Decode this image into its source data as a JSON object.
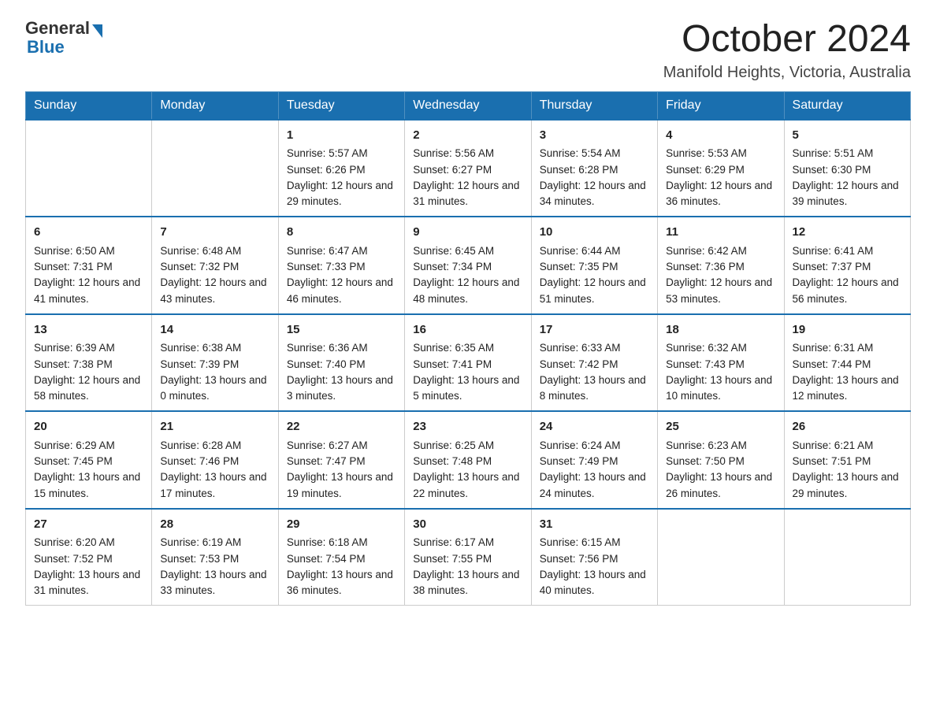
{
  "logo": {
    "text_general": "General",
    "text_blue": "Blue"
  },
  "title": "October 2024",
  "subtitle": "Manifold Heights, Victoria, Australia",
  "days_of_week": [
    "Sunday",
    "Monday",
    "Tuesday",
    "Wednesday",
    "Thursday",
    "Friday",
    "Saturday"
  ],
  "weeks": [
    [
      {
        "day": "",
        "sunrise": "",
        "sunset": "",
        "daylight": ""
      },
      {
        "day": "",
        "sunrise": "",
        "sunset": "",
        "daylight": ""
      },
      {
        "day": "1",
        "sunrise": "Sunrise: 5:57 AM",
        "sunset": "Sunset: 6:26 PM",
        "daylight": "Daylight: 12 hours and 29 minutes."
      },
      {
        "day": "2",
        "sunrise": "Sunrise: 5:56 AM",
        "sunset": "Sunset: 6:27 PM",
        "daylight": "Daylight: 12 hours and 31 minutes."
      },
      {
        "day": "3",
        "sunrise": "Sunrise: 5:54 AM",
        "sunset": "Sunset: 6:28 PM",
        "daylight": "Daylight: 12 hours and 34 minutes."
      },
      {
        "day": "4",
        "sunrise": "Sunrise: 5:53 AM",
        "sunset": "Sunset: 6:29 PM",
        "daylight": "Daylight: 12 hours and 36 minutes."
      },
      {
        "day": "5",
        "sunrise": "Sunrise: 5:51 AM",
        "sunset": "Sunset: 6:30 PM",
        "daylight": "Daylight: 12 hours and 39 minutes."
      }
    ],
    [
      {
        "day": "6",
        "sunrise": "Sunrise: 6:50 AM",
        "sunset": "Sunset: 7:31 PM",
        "daylight": "Daylight: 12 hours and 41 minutes."
      },
      {
        "day": "7",
        "sunrise": "Sunrise: 6:48 AM",
        "sunset": "Sunset: 7:32 PM",
        "daylight": "Daylight: 12 hours and 43 minutes."
      },
      {
        "day": "8",
        "sunrise": "Sunrise: 6:47 AM",
        "sunset": "Sunset: 7:33 PM",
        "daylight": "Daylight: 12 hours and 46 minutes."
      },
      {
        "day": "9",
        "sunrise": "Sunrise: 6:45 AM",
        "sunset": "Sunset: 7:34 PM",
        "daylight": "Daylight: 12 hours and 48 minutes."
      },
      {
        "day": "10",
        "sunrise": "Sunrise: 6:44 AM",
        "sunset": "Sunset: 7:35 PM",
        "daylight": "Daylight: 12 hours and 51 minutes."
      },
      {
        "day": "11",
        "sunrise": "Sunrise: 6:42 AM",
        "sunset": "Sunset: 7:36 PM",
        "daylight": "Daylight: 12 hours and 53 minutes."
      },
      {
        "day": "12",
        "sunrise": "Sunrise: 6:41 AM",
        "sunset": "Sunset: 7:37 PM",
        "daylight": "Daylight: 12 hours and 56 minutes."
      }
    ],
    [
      {
        "day": "13",
        "sunrise": "Sunrise: 6:39 AM",
        "sunset": "Sunset: 7:38 PM",
        "daylight": "Daylight: 12 hours and 58 minutes."
      },
      {
        "day": "14",
        "sunrise": "Sunrise: 6:38 AM",
        "sunset": "Sunset: 7:39 PM",
        "daylight": "Daylight: 13 hours and 0 minutes."
      },
      {
        "day": "15",
        "sunrise": "Sunrise: 6:36 AM",
        "sunset": "Sunset: 7:40 PM",
        "daylight": "Daylight: 13 hours and 3 minutes."
      },
      {
        "day": "16",
        "sunrise": "Sunrise: 6:35 AM",
        "sunset": "Sunset: 7:41 PM",
        "daylight": "Daylight: 13 hours and 5 minutes."
      },
      {
        "day": "17",
        "sunrise": "Sunrise: 6:33 AM",
        "sunset": "Sunset: 7:42 PM",
        "daylight": "Daylight: 13 hours and 8 minutes."
      },
      {
        "day": "18",
        "sunrise": "Sunrise: 6:32 AM",
        "sunset": "Sunset: 7:43 PM",
        "daylight": "Daylight: 13 hours and 10 minutes."
      },
      {
        "day": "19",
        "sunrise": "Sunrise: 6:31 AM",
        "sunset": "Sunset: 7:44 PM",
        "daylight": "Daylight: 13 hours and 12 minutes."
      }
    ],
    [
      {
        "day": "20",
        "sunrise": "Sunrise: 6:29 AM",
        "sunset": "Sunset: 7:45 PM",
        "daylight": "Daylight: 13 hours and 15 minutes."
      },
      {
        "day": "21",
        "sunrise": "Sunrise: 6:28 AM",
        "sunset": "Sunset: 7:46 PM",
        "daylight": "Daylight: 13 hours and 17 minutes."
      },
      {
        "day": "22",
        "sunrise": "Sunrise: 6:27 AM",
        "sunset": "Sunset: 7:47 PM",
        "daylight": "Daylight: 13 hours and 19 minutes."
      },
      {
        "day": "23",
        "sunrise": "Sunrise: 6:25 AM",
        "sunset": "Sunset: 7:48 PM",
        "daylight": "Daylight: 13 hours and 22 minutes."
      },
      {
        "day": "24",
        "sunrise": "Sunrise: 6:24 AM",
        "sunset": "Sunset: 7:49 PM",
        "daylight": "Daylight: 13 hours and 24 minutes."
      },
      {
        "day": "25",
        "sunrise": "Sunrise: 6:23 AM",
        "sunset": "Sunset: 7:50 PM",
        "daylight": "Daylight: 13 hours and 26 minutes."
      },
      {
        "day": "26",
        "sunrise": "Sunrise: 6:21 AM",
        "sunset": "Sunset: 7:51 PM",
        "daylight": "Daylight: 13 hours and 29 minutes."
      }
    ],
    [
      {
        "day": "27",
        "sunrise": "Sunrise: 6:20 AM",
        "sunset": "Sunset: 7:52 PM",
        "daylight": "Daylight: 13 hours and 31 minutes."
      },
      {
        "day": "28",
        "sunrise": "Sunrise: 6:19 AM",
        "sunset": "Sunset: 7:53 PM",
        "daylight": "Daylight: 13 hours and 33 minutes."
      },
      {
        "day": "29",
        "sunrise": "Sunrise: 6:18 AM",
        "sunset": "Sunset: 7:54 PM",
        "daylight": "Daylight: 13 hours and 36 minutes."
      },
      {
        "day": "30",
        "sunrise": "Sunrise: 6:17 AM",
        "sunset": "Sunset: 7:55 PM",
        "daylight": "Daylight: 13 hours and 38 minutes."
      },
      {
        "day": "31",
        "sunrise": "Sunrise: 6:15 AM",
        "sunset": "Sunset: 7:56 PM",
        "daylight": "Daylight: 13 hours and 40 minutes."
      },
      {
        "day": "",
        "sunrise": "",
        "sunset": "",
        "daylight": ""
      },
      {
        "day": "",
        "sunrise": "",
        "sunset": "",
        "daylight": ""
      }
    ]
  ]
}
